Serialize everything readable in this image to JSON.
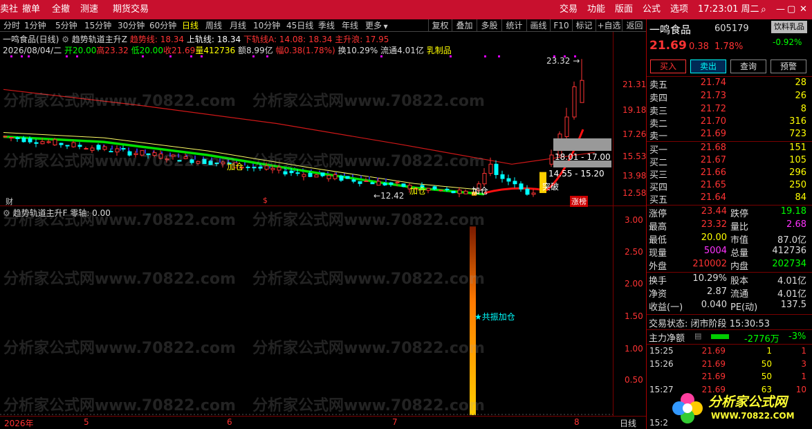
{
  "menu": {
    "items": [
      "卖社",
      "撤单",
      "全撤",
      "测速",
      "期货交易"
    ],
    "right_items": [
      "交易",
      "功能",
      "版面",
      "公式",
      "选项"
    ],
    "clock": "17:23:01 周二",
    "icons": [
      "search-icon",
      "minimize-icon",
      "maximize-icon",
      "close-icon"
    ]
  },
  "toolbar": {
    "timeframes": [
      "分时",
      "1分钟",
      "5分钟",
      "15分钟",
      "30分钟",
      "60分钟",
      "日线",
      "周线",
      "月线",
      "10分钟",
      "45日线",
      "季线",
      "年线",
      "更多"
    ],
    "selected": "日线",
    "buttons": [
      "复权",
      "叠加",
      "多股",
      "统计",
      "画线",
      "F10",
      "标记",
      "+自选",
      "返回"
    ]
  },
  "chart_header": {
    "stock": "一鸣食品(日线)",
    "indicator": "趋势轨道主升Z",
    "trend_line": "趋势线: 18.34",
    "upper": "上轨线: 18.34",
    "lower": "下轨线A: 14.08",
    "lower_b": ": 18.34",
    "main_rise": "主升浪: 17.95",
    "date": "2026/08/04/二",
    "open": "开20.00",
    "high": "高23.32",
    "low": "低20.00",
    "close": "收21.69",
    "volume": "量412736",
    "amount": "额8.99亿",
    "range": "幅0.38(1.78%)",
    "turnover": "换10.29%",
    "float": "流通4.01亿",
    "sector": "乳制品"
  },
  "main_axis": [
    "21.31",
    "19.18",
    "17.26",
    "15.53",
    "13.98",
    "12.58"
  ],
  "annotations": {
    "high_label": "23.32",
    "low_label": "12.42",
    "zone_upper": "18.01 - 17.00",
    "zone_lower": "14.55 - 15.20",
    "add_1": "加仓",
    "add_2": "加仓",
    "add_3": "加仓",
    "breakout": "突破",
    "cai": "财",
    "s": "$",
    "limit_up": "涨榜"
  },
  "sub_header": {
    "indicator": "趋势轨道主升F",
    "zero": "零轴: 0.00"
  },
  "sub_axis": [
    "3.00",
    "2.50",
    "2.00",
    "1.50",
    "1.00",
    "0.50"
  ],
  "sub_annotation": "★共振加仓",
  "x_axis": {
    "labels": [
      "2026年",
      "5",
      "6",
      "7",
      "8"
    ],
    "period": "日线"
  },
  "watermark": "分析家公式网www.70822.com",
  "quote": {
    "name": "一鸣食品",
    "code": "605179",
    "sector": "饮料乳品",
    "sector_change": "-0.92%",
    "price": "21.69",
    "change": "0.38",
    "change_pct": "1.78%",
    "buttons": [
      "买入",
      "卖出",
      "查询",
      "预警"
    ],
    "asks": [
      {
        "label": "卖五",
        "price": "21.74",
        "vol": "28"
      },
      {
        "label": "卖四",
        "price": "21.73",
        "vol": "26"
      },
      {
        "label": "卖三",
        "price": "21.72",
        "vol": "8"
      },
      {
        "label": "卖二",
        "price": "21.70",
        "vol": "316"
      },
      {
        "label": "卖一",
        "price": "21.69",
        "vol": "723"
      }
    ],
    "bids": [
      {
        "label": "买一",
        "price": "21.68",
        "vol": "151"
      },
      {
        "label": "买二",
        "price": "21.67",
        "vol": "105"
      },
      {
        "label": "买三",
        "price": "21.66",
        "vol": "296"
      },
      {
        "label": "买四",
        "price": "21.65",
        "vol": "250"
      },
      {
        "label": "买五",
        "price": "21.64",
        "vol": "84"
      }
    ],
    "stats": [
      {
        "k1": "涨停",
        "v1": "23.44",
        "k2": "跌停",
        "v2": "19.18"
      },
      {
        "k1": "最高",
        "v1": "23.32",
        "k2": "量比",
        "v2": "2.68"
      },
      {
        "k1": "最低",
        "v1": "20.00",
        "k2": "市值",
        "v2": "87.0亿"
      },
      {
        "k1": "现量",
        "v1": "5004",
        "k2": "总量",
        "v2": "412736"
      },
      {
        "k1": "外盘",
        "v1": "210002",
        "k2": "内盘",
        "v2": "202734"
      }
    ],
    "stats2": [
      {
        "k1": "换手",
        "v1": "10.29%",
        "k2": "股本",
        "v2": "4.01亿"
      },
      {
        "k1": "净资",
        "v1": "2.87",
        "k2": "流通",
        "v2": "4.01亿"
      },
      {
        "k1": "收益(一)",
        "v1": "0.040",
        "k2": "PE(动)",
        "v2": "137.5"
      }
    ],
    "trade_status_label": "交易状态:",
    "trade_status": "闭市阶段",
    "trade_time": "15:30:53",
    "main_net_label": "主力净额",
    "main_net": "-2776万",
    "main_net_pct": "-3%",
    "ticks": [
      {
        "t": "15:25",
        "p": "21.69",
        "v": "1",
        "d": "1"
      },
      {
        "t": "15:26",
        "p": "21.69",
        "v": "50",
        "d": "3"
      },
      {
        "t": "",
        "p": "21.69",
        "v": "50",
        "d": "1"
      },
      {
        "t": "15:27",
        "p": "21.69",
        "v": "63",
        "d": "10"
      },
      {
        "t": "15:2",
        "p": "",
        "v": "",
        "d": ""
      }
    ],
    "logo_text": "分析家公式网",
    "logo_url": "WWW.70822.COM"
  },
  "colors": {
    "menubar": "#c8102e",
    "up": "#ff3333",
    "down": "#00ffff",
    "yellow": "#ffff00",
    "green": "#00ff00",
    "ma": "#ff2020"
  },
  "chart_data": {
    "type": "line",
    "x": [
      "2026-04",
      "2026-05",
      "2026-06",
      "2026-07",
      "2026-08"
    ],
    "series": [
      {
        "values": [
          17.4,
          17.0,
          16.0,
          14.7,
          13.5,
          13.0,
          17.95
        ]
      },
      {
        "values": [
          21.0,
          19.8,
          18.4,
          16.8,
          15.3,
          16.2
        ]
      }
    ],
    "ylim": [
      12.2,
      23.6
    ],
    "sub_chart": {
      "type": "bar",
      "values": [
        3.0
      ],
      "ylim": [
        0,
        3.1
      ]
    }
  }
}
